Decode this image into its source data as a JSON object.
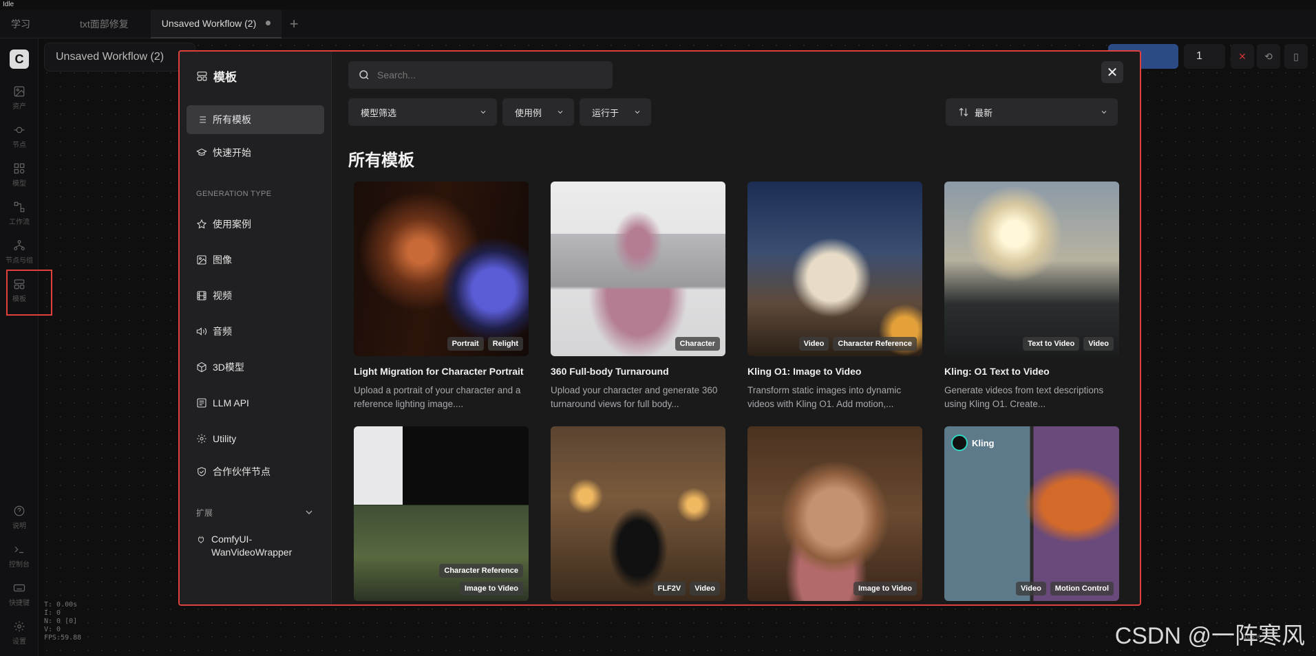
{
  "status": "Idle",
  "tabs": [
    {
      "label": "学习"
    },
    {
      "label": "txt面部修复"
    },
    {
      "label": "Unsaved Workflow (2)"
    }
  ],
  "workflow_title": "Unsaved Workflow (2)",
  "rail": [
    {
      "label": "资产",
      "icon": "image-icon"
    },
    {
      "label": "节点",
      "icon": "node-icon"
    },
    {
      "label": "模型",
      "icon": "model-icon"
    },
    {
      "label": "工作流",
      "icon": "workflow-icon"
    },
    {
      "label": "节点与组",
      "icon": "node-group-icon"
    },
    {
      "label": "模板",
      "icon": "template-icon"
    },
    {
      "label": "说明",
      "icon": "help-icon"
    },
    {
      "label": "控制台",
      "icon": "terminal-icon"
    },
    {
      "label": "快捷键",
      "icon": "keyboard-icon"
    },
    {
      "label": "设置",
      "icon": "gear-icon"
    }
  ],
  "stats": [
    "T: 0.00s",
    "I: 0",
    "N: 0 [0]",
    "V: 0",
    "FPS:59.88"
  ],
  "run_count": "1",
  "modal": {
    "title": "模板",
    "nav": [
      {
        "label": "所有模板"
      },
      {
        "label": "快速开始"
      }
    ],
    "generation_type_label": "GENERATION TYPE",
    "gen_nav": [
      {
        "label": "使用案例"
      },
      {
        "label": "图像"
      },
      {
        "label": "视频"
      },
      {
        "label": "音频"
      },
      {
        "label": "3D模型"
      },
      {
        "label": "LLM API"
      },
      {
        "label": "Utility"
      },
      {
        "label": "合作伙伴节点"
      }
    ],
    "extensions_label": "扩展",
    "extension_item": "ComfyUI-WanVideoWrapper",
    "search_placeholder": "Search...",
    "filters": {
      "model": "模型筛选",
      "use_case": "使用例",
      "runs_on": "运行于",
      "sort": "最新"
    },
    "section_title": "所有模板",
    "cards": [
      {
        "title": "Light Migration for Character Portrait",
        "desc": "Upload a portrait of your character and a reference lighting image....",
        "badges": [
          "Portrait",
          "Relight"
        ]
      },
      {
        "title": "360 Full-body Turnaround",
        "desc": "Upload your character and generate 360 turnaround views for full body...",
        "badges": [
          "Character"
        ]
      },
      {
        "title": "Kling O1: Image to Video",
        "desc": "Transform static images into dynamic videos with Kling O1. Add motion,...",
        "badges": [
          "Video",
          "Character Reference"
        ]
      },
      {
        "title": "Kling: O1 Text to Video",
        "desc": "Generate videos from text descriptions using Kling O1. Create...",
        "badges": [
          "Text to Video",
          "Video"
        ]
      },
      {
        "title": "",
        "desc": "",
        "badges": [
          "Character Reference",
          "Image to Video"
        ]
      },
      {
        "title": "",
        "desc": "",
        "badges": [
          "FLF2V",
          "Video"
        ]
      },
      {
        "title": "",
        "desc": "",
        "badges": [
          "Image to Video"
        ]
      },
      {
        "title": "",
        "desc": "",
        "badges": [
          "Video",
          "Motion Control"
        ],
        "brand": "Kling"
      }
    ]
  },
  "watermark": "CSDN @一阵寒风",
  "zoom": "103%"
}
